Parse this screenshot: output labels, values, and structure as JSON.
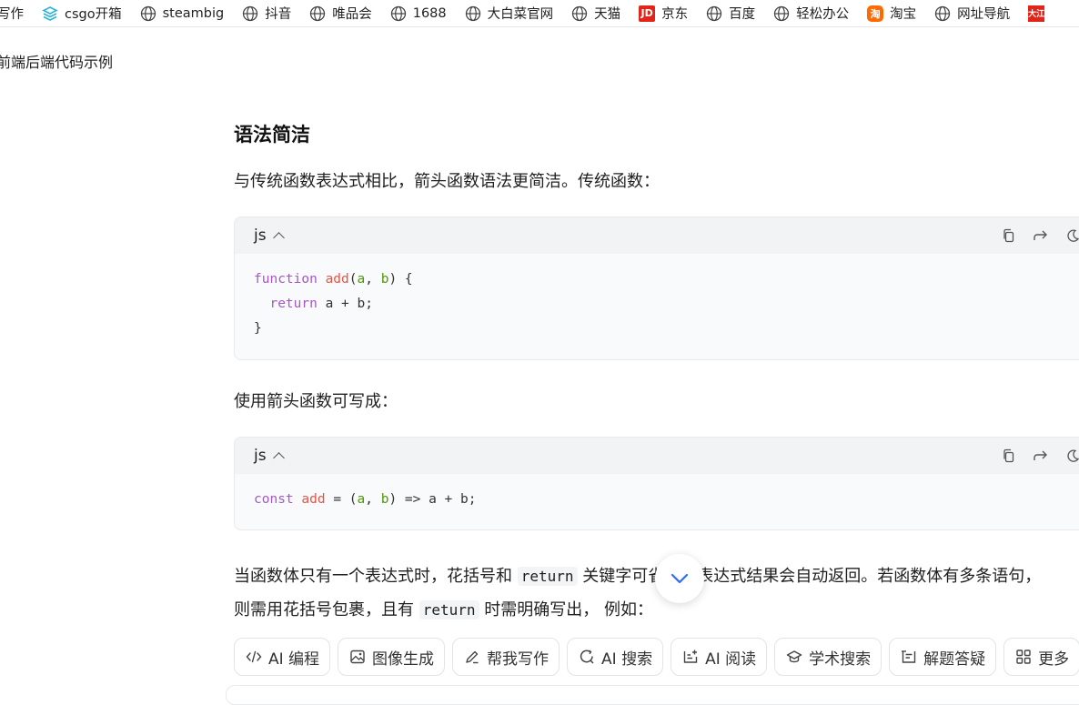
{
  "bookmarks": [
    {
      "label": "写作",
      "icon": "none"
    },
    {
      "label": "csgo开箱",
      "icon": "stack-icon"
    },
    {
      "label": "steambig",
      "icon": "globe-icon"
    },
    {
      "label": "抖音",
      "icon": "globe-icon"
    },
    {
      "label": "唯品会",
      "icon": "globe-icon"
    },
    {
      "label": "1688",
      "icon": "globe-icon"
    },
    {
      "label": "大白菜官网",
      "icon": "globe-icon"
    },
    {
      "label": "天猫",
      "icon": "globe-icon"
    },
    {
      "label": "京东",
      "icon": "jd-icon",
      "icon_text": "JD"
    },
    {
      "label": "百度",
      "icon": "globe-icon"
    },
    {
      "label": "轻松办公",
      "icon": "globe-icon"
    },
    {
      "label": "淘宝",
      "icon": "taobao-icon",
      "icon_text": "淘"
    },
    {
      "label": "网址导航",
      "icon": "globe-icon"
    },
    {
      "label": "",
      "icon": "red-logo-icon",
      "icon_text": "大江"
    }
  ],
  "page": {
    "title": "前端后端代码示例"
  },
  "article": {
    "heading": "语法简洁",
    "p1": "与传统函数表达式相比，箭头函数语法更简洁。传统函数：",
    "p2": "使用箭头函数可写成：",
    "p3_a": "当函数体只有一个表达式时，花括号和 ",
    "p3_code1": "return",
    "p3_b": " 关键字可省略，表达式结果会自动返回。若函数体有多条语句，",
    "p3_c": "则需用花括号包裹，且有 ",
    "p3_code2": "return",
    "p3_d": " 时需明确写出， 例如："
  },
  "code_blocks": [
    {
      "lang": "js",
      "lines": [
        [
          {
            "t": "function",
            "c": "kw"
          },
          {
            "t": " "
          },
          {
            "t": "add",
            "c": "fn"
          },
          {
            "t": "("
          },
          {
            "t": "a",
            "c": "pm"
          },
          {
            "t": ", "
          },
          {
            "t": "b",
            "c": "pm"
          },
          {
            "t": ") {"
          }
        ],
        [
          {
            "t": "  "
          },
          {
            "t": "return",
            "c": "kw"
          },
          {
            "t": " a + b;"
          }
        ],
        [
          {
            "t": "}"
          }
        ]
      ]
    },
    {
      "lang": "js",
      "lines": [
        [
          {
            "t": "const",
            "c": "kw"
          },
          {
            "t": " "
          },
          {
            "t": "add",
            "c": "fn"
          },
          {
            "t": " = ("
          },
          {
            "t": "a",
            "c": "pm"
          },
          {
            "t": ", "
          },
          {
            "t": "b",
            "c": "pm"
          },
          {
            "t": ") => a + b;"
          }
        ]
      ]
    }
  ],
  "toolbar": [
    {
      "label": "AI 编程",
      "icon": "code-icon"
    },
    {
      "label": "图像生成",
      "icon": "image-icon"
    },
    {
      "label": "帮我写作",
      "icon": "pen-icon"
    },
    {
      "label": "AI 搜索",
      "icon": "search-refresh-icon"
    },
    {
      "label": "AI 阅读",
      "icon": "read-icon"
    },
    {
      "label": "学术搜索",
      "icon": "cap-icon"
    },
    {
      "label": "解题答疑",
      "icon": "answer-icon"
    },
    {
      "label": "更多",
      "icon": "grid-icon"
    }
  ],
  "colors": {
    "keyword": "#a457c6",
    "function_name": "#e45649",
    "param": "#4e9a06",
    "csgo_icon": "#2bb3d6",
    "jd_brand": "#e1251b",
    "taobao_brand": "#ff6a00"
  }
}
